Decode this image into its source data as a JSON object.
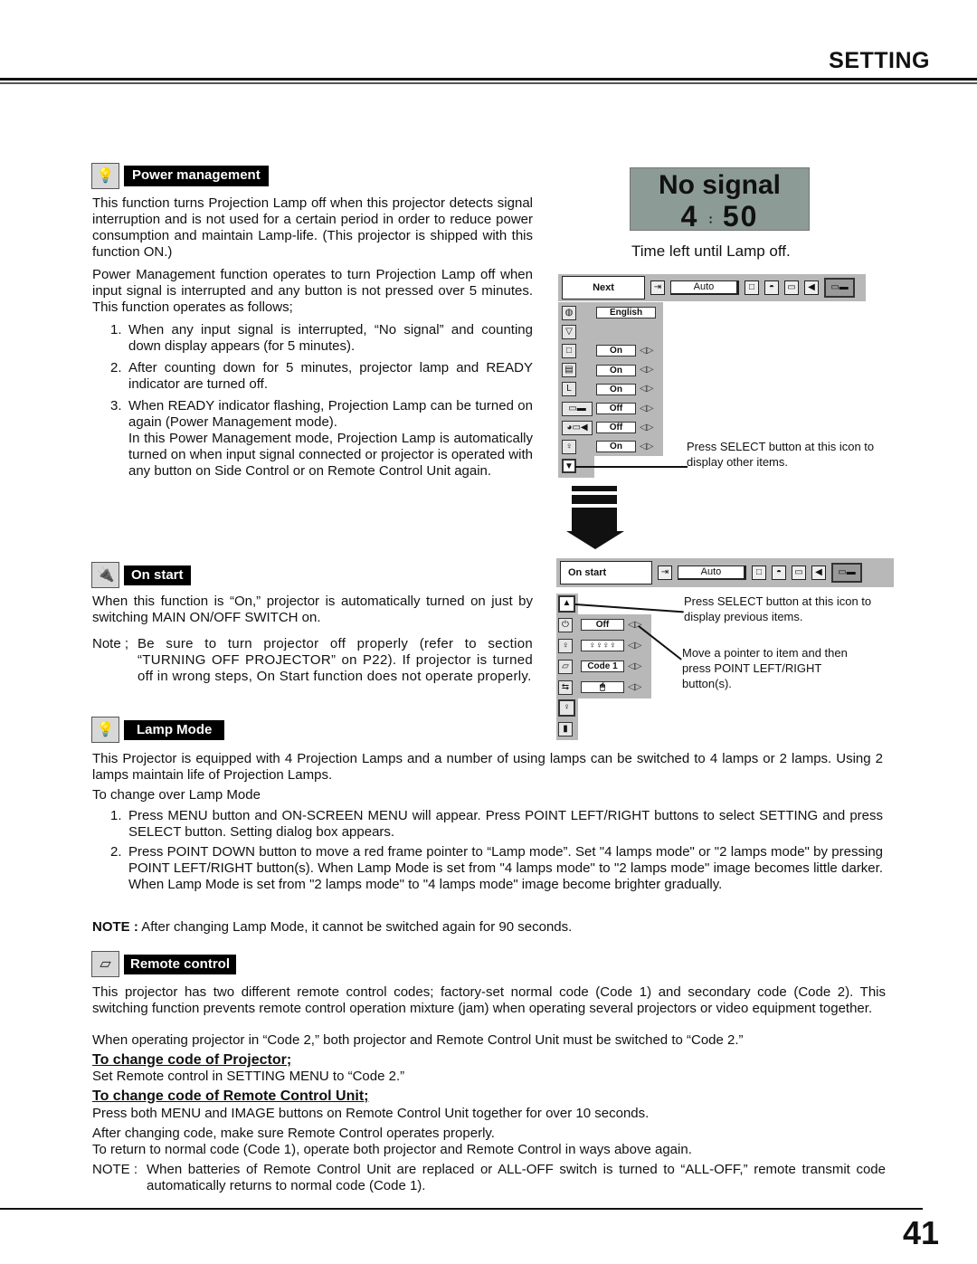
{
  "header": {
    "title": "SETTING"
  },
  "power_management": {
    "icon": "lamp-bulb-icon",
    "label": "Power management",
    "p1": "This function turns Projection Lamp off when this projector detects signal interruption and is not used for a certain period in order to reduce power consumption and maintain Lamp-life. (This projector is shipped with this function ON.)",
    "p2": "Power Management function operates to turn Projection Lamp off when input signal is interrupted and any button is not pressed over 5 minutes. This function operates as follows;",
    "steps": [
      {
        "num": "1.",
        "text": "When any input signal is interrupted, “No signal” and counting down display appears (for 5 minutes)."
      },
      {
        "num": "2.",
        "text": "After counting down for 5 minutes, projector lamp and READY indicator are turned off."
      },
      {
        "num": "3.",
        "text": "When READY indicator flashing, Projection Lamp can be turned on again (Power Management mode)."
      }
    ],
    "step3_extra": "In this Power Management mode, Projection Lamp is automatically turned on when input signal connected or projector is operated with any button on Side Control or on Remote Control Unit again."
  },
  "lcd": {
    "line1": "No signal",
    "minutes": "4",
    "colon": ":",
    "seconds": "50",
    "caption": "Time left until Lamp off."
  },
  "menu1": {
    "title": "Next",
    "auto": "Auto",
    "rows": [
      {
        "icon": "globe-icon",
        "value": "English",
        "arrows": false
      },
      {
        "icon": "keystone-icon",
        "value": "",
        "arrows": false
      },
      {
        "icon": "blue-back-icon",
        "value": "On",
        "arrows": true
      },
      {
        "icon": "display-icon",
        "value": "On",
        "arrows": true
      },
      {
        "icon": "logo-icon",
        "value": "On",
        "arrows": true
      },
      {
        "icon": "ceiling-icon",
        "value": "Off",
        "arrows": true
      },
      {
        "icon": "rear-icon",
        "value": "Off",
        "arrows": true
      },
      {
        "icon": "power-management-icon",
        "value": "On",
        "arrows": true
      }
    ],
    "callout": "Press SELECT button at this icon to display other items."
  },
  "menu2": {
    "title": "On start",
    "auto": "Auto",
    "rows": [
      {
        "icon": "on-start-icon",
        "value": "Off"
      },
      {
        "icon": "lamp-mode-icon",
        "value": "♀♀♀♀"
      },
      {
        "icon": "remote-control-icon",
        "value": "Code 1"
      },
      {
        "icon": "usb-icon",
        "value": "🖱"
      }
    ],
    "callout_prev": "Press SELECT button at this icon to display previous items.",
    "callout_pointer": "Move a pointer to item and then press POINT LEFT/RIGHT button(s)."
  },
  "on_start": {
    "label": "On start",
    "p1": "When this function is “On,” projector is automatically turned on just by switching MAIN ON/OFF SWITCH on.",
    "note_label": "Note ;",
    "note": "Be sure to turn projector off properly (refer to section “TURNING OFF PROJECTOR” on P22). If projector is turned off in wrong steps, On Start function does not operate properly."
  },
  "lamp_mode": {
    "label": "Lamp Mode",
    "p1": "This Projector is equipped with 4 Projection Lamps and a number of using lamps can be switched to 4 lamps or 2 lamps. Using 2 lamps maintain life of Projection Lamps.",
    "p2": "To change over Lamp Mode",
    "steps": [
      {
        "num": "1.",
        "text": "Press MENU button and ON-SCREEN MENU will appear. Press POINT LEFT/RIGHT buttons to select SETTING and press SELECT button. Setting dialog box appears."
      },
      {
        "num": "2.",
        "text": "Press POINT DOWN button to move a red frame pointer to “Lamp mode”. Set \"4 lamps mode\" or \"2 lamps mode\" by pressing POINT LEFT/RIGHT button(s). When Lamp Mode is set from \"4 lamps mode\" to \"2 lamps mode\" image becomes little darker. When Lamp Mode is set from \"2 lamps mode\" to \"4 lamps mode\" image become brighter gradually."
      }
    ],
    "note_label": "NOTE :",
    "note": "After changing Lamp Mode, it cannot be switched again for 90 seconds."
  },
  "remote_control": {
    "label": "Remote control",
    "p1": "This projector has two different remote control codes; factory-set normal code (Code 1) and secondary code (Code 2). This switching function prevents remote control operation mixture (jam) when operating several projectors or video equipment together.",
    "p2": "When operating projector in “Code 2,” both projector and Remote Control Unit must be switched to “Code 2.”",
    "h1": "To change code of Projector;",
    "h1_text": "Set Remote control in SETTING MENU to “Code 2.”",
    "h2": "To change code of Remote Control Unit;",
    "h2_text": "Press both MENU and IMAGE buttons on Remote Control Unit together for over 10 seconds.",
    "p3": "After changing code, make sure Remote Control operates properly.",
    "p4": "To return to normal code (Code 1), operate both projector and Remote Control in ways above again.",
    "note_label": "NOTE :",
    "note": "When batteries of Remote Control Unit are replaced or ALL-OFF switch is turned to “ALL-OFF,” remote transmit code automatically returns to normal code (Code 1)."
  },
  "footer": {
    "page_number": "41"
  }
}
